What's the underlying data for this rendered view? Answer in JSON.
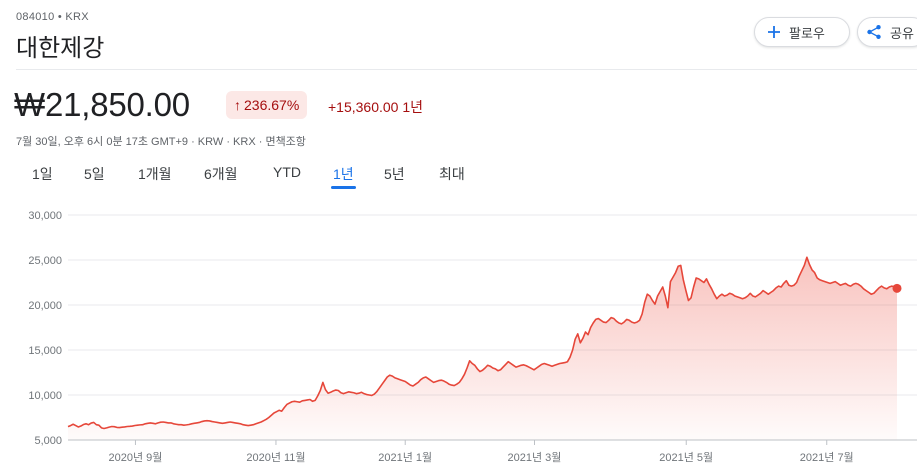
{
  "header": {
    "ticker": "084010 • KRX",
    "company": "대한제강",
    "follow_label": "팔로우",
    "share_label": "공유"
  },
  "quote": {
    "price": "₩21,850.00",
    "change_percent": "236.67%",
    "change_abs": "+15,360.00 1년",
    "meta": "7월 30일, 오후 6시 0분 17초 GMT+9 · KRW · KRX · 면책조항"
  },
  "tabs": [
    {
      "label": "1일",
      "active": false
    },
    {
      "label": "5일",
      "active": false
    },
    {
      "label": "1개월",
      "active": false
    },
    {
      "label": "6개월",
      "active": false
    },
    {
      "label": "YTD",
      "active": false
    },
    {
      "label": "1년",
      "active": true
    },
    {
      "label": "5년",
      "active": false
    },
    {
      "label": "최대",
      "active": false
    }
  ],
  "colors": {
    "line": "#e6473a",
    "fill": "#ea4335",
    "up": "#a50e0e",
    "accent": "#1a73e8"
  },
  "chart_data": {
    "type": "area",
    "ylim": [
      5000,
      30000
    ],
    "yticks": [
      5000,
      10000,
      15000,
      20000,
      25000,
      30000
    ],
    "ytick_labels": [
      "5,000",
      "10,000",
      "15,000",
      "20,000",
      "25,000",
      "30,000"
    ],
    "xtick_labels": [
      "2020년 9월",
      "2020년 11월",
      "2021년 1월",
      "2021년 3월",
      "2021년 5월",
      "2021년 7월"
    ],
    "xtick_index": [
      24,
      74,
      120,
      166,
      220,
      270
    ],
    "x_domain": [
      0,
      295
    ],
    "series": [
      {
        "values": [
          6490,
          6600,
          6750,
          6600,
          6450,
          6550,
          6720,
          6800,
          6700,
          6880,
          6950,
          6700,
          6650,
          6350,
          6280,
          6350,
          6430,
          6500,
          6480,
          6400,
          6380,
          6420,
          6450,
          6500,
          6520,
          6550,
          6610,
          6650,
          6680,
          6700,
          6800,
          6850,
          6900,
          6850,
          6800,
          6900,
          6980,
          7000,
          6950,
          6900,
          6900,
          6800,
          6750,
          6700,
          6700,
          6650,
          6680,
          6720,
          6800,
          6850,
          6900,
          6950,
          7050,
          7120,
          7150,
          7120,
          7050,
          7000,
          6950,
          6900,
          6850,
          6900,
          6950,
          7000,
          6950,
          6900,
          6850,
          6800,
          6700,
          6650,
          6600,
          6650,
          6700,
          6800,
          6900,
          7000,
          7150,
          7300,
          7500,
          7750,
          8000,
          8150,
          8300,
          8200,
          8600,
          8950,
          9100,
          9250,
          9300,
          9250,
          9200,
          9350,
          9400,
          9450,
          9500,
          9300,
          9400,
          9900,
          10500,
          11400,
          10600,
          10200,
          10300,
          10450,
          10550,
          10500,
          10250,
          10150,
          10250,
          10350,
          10300,
          10250,
          10150,
          10200,
          10300,
          10150,
          10050,
          10000,
          9950,
          10100,
          10400,
          10800,
          11200,
          11600,
          12000,
          12200,
          12100,
          11900,
          11800,
          11700,
          11600,
          11500,
          11300,
          11100,
          11000,
          11200,
          11400,
          11700,
          11900,
          12000,
          11800,
          11600,
          11400,
          11500,
          11600,
          11650,
          11550,
          11400,
          11200,
          11100,
          11050,
          11200,
          11400,
          11800,
          12300,
          13000,
          13800,
          13500,
          13300,
          12900,
          12600,
          12750,
          13000,
          13300,
          13200,
          13000,
          12900,
          12700,
          12800,
          13100,
          13400,
          13700,
          13500,
          13300,
          13100,
          13200,
          13300,
          13350,
          13250,
          13100,
          12950,
          12800,
          13000,
          13200,
          13400,
          13500,
          13400,
          13300,
          13200,
          13300,
          13400,
          13500,
          13550,
          13600,
          13700,
          14200,
          15000,
          16200,
          16800,
          15800,
          16300,
          17000,
          16700,
          17500,
          18000,
          18400,
          18500,
          18300,
          18100,
          18050,
          18300,
          18600,
          18500,
          18200,
          18000,
          17900,
          18100,
          18400,
          18300,
          18100,
          18000,
          18100,
          18300,
          19000,
          20300,
          21200,
          21000,
          20500,
          20100,
          21000,
          21500,
          22000,
          21000,
          19700,
          22600,
          23100,
          23600,
          24300,
          24400,
          22800,
          21600,
          20500,
          20800,
          22000,
          23000,
          22900,
          22700,
          22500,
          22900,
          22300,
          21800,
          21200,
          20700,
          21000,
          21200,
          21000,
          21100,
          21300,
          21200,
          21000,
          20900,
          20800,
          20700,
          20800,
          21000,
          21300,
          21000,
          20900,
          21100,
          21300,
          21600,
          21400,
          21200,
          21400,
          21600,
          21900,
          22100,
          22000,
          22400,
          22700,
          22200,
          22100,
          22200,
          22500,
          23200,
          23800,
          24400,
          25300,
          24500,
          23900,
          23600,
          23000,
          22800,
          22700,
          22600,
          22500,
          22400,
          22500,
          22600,
          22400,
          22200,
          22300,
          22400,
          22200,
          22100,
          22300,
          22400,
          22300,
          22100,
          21800,
          21600,
          21400,
          21200,
          21300,
          21600,
          21900,
          22100,
          21900,
          21800,
          22000,
          22100,
          22000,
          21850
        ]
      }
    ]
  }
}
